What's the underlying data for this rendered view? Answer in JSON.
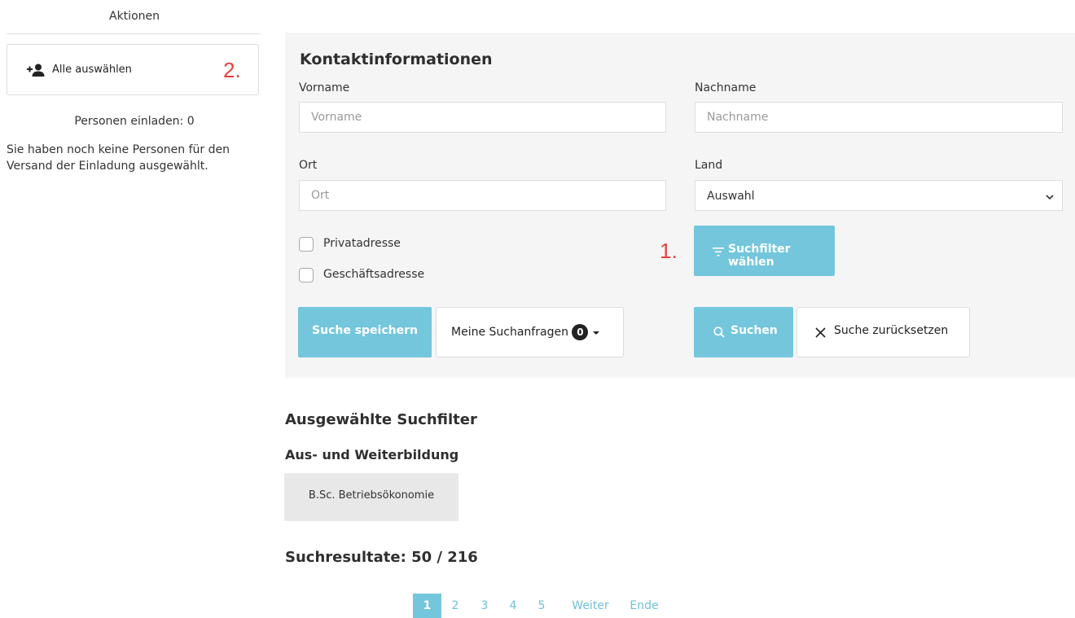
{
  "sidebar": {
    "title": "Aktionen",
    "select_all_label": "Alle auswählen",
    "annotation": "2.",
    "invite_count": "Personen einladen: 0",
    "invite_note": "Sie haben noch keine Personen für den Versand der Einladung ausgewählt."
  },
  "search": {
    "heading": "Kontaktinformationen",
    "firstname_label": "Vorname",
    "firstname_placeholder": "Vorname",
    "lastname_label": "Nachname",
    "lastname_placeholder": "Nachname",
    "city_label": "Ort",
    "city_placeholder": "Ort",
    "country_label": "Land",
    "country_selected": "Auswahl",
    "private_address_label": "Privatadresse",
    "business_address_label": "Geschäftsadresse",
    "filter_button": "Suchfilter wählen",
    "filter_annotation": "1.",
    "save_search_button": "Suche speichern",
    "my_queries_button": "Meine Suchanfragen",
    "my_queries_count": "0",
    "search_button": "Suchen",
    "reset_button": "Suche zurücksetzen"
  },
  "selected_filters": {
    "heading": "Ausgewählte Suchfilter",
    "group_heading": "Aus- und Weiterbildung",
    "chip": "B.Sc. Betriebsökonomie"
  },
  "results": {
    "heading": "Suchresultate: 50 / 216"
  },
  "pagination": {
    "pages": [
      "1",
      "2",
      "3",
      "4",
      "5"
    ],
    "active_page": "1",
    "next": "Weiter",
    "last": "Ende"
  },
  "colors": {
    "primary": "#74c6dc",
    "annotation": "#e8413c",
    "panel_bg": "#f5f5f5",
    "chip_bg": "#e8e8e8"
  }
}
